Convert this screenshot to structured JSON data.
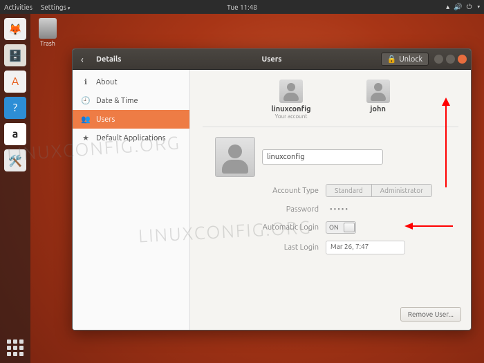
{
  "panel": {
    "activities": "Activities",
    "app_menu": "Settings",
    "clock": "Tue 11:48"
  },
  "desktop": {
    "trash_label": "Trash"
  },
  "dock": {
    "items": [
      {
        "name": "firefox",
        "bg": "#f0f0f0",
        "glyph": "🦊"
      },
      {
        "name": "files",
        "bg": "#e0ddd7",
        "glyph": "📁"
      },
      {
        "name": "software",
        "bg": "#f2f2f2",
        "glyph": "🛍️"
      },
      {
        "name": "help",
        "bg": "#2d8ed6",
        "glyph": "?"
      },
      {
        "name": "amazon",
        "bg": "#ffffff",
        "glyph": "a"
      },
      {
        "name": "settings",
        "bg": "#e9e9e9",
        "glyph": "⚙"
      }
    ]
  },
  "window": {
    "back_section": "Details",
    "title": "Users",
    "unlock_label": "Unlock"
  },
  "sidebar": {
    "items": [
      {
        "icon": "ℹ",
        "label": "About"
      },
      {
        "icon": "🕘",
        "label": "Date & Time"
      },
      {
        "icon": "👥",
        "label": "Users"
      },
      {
        "icon": "★",
        "label": "Default Applications"
      }
    ],
    "active_index": 2
  },
  "users": {
    "list": [
      {
        "name": "linuxconfig",
        "sub": "Your account"
      },
      {
        "name": "john",
        "sub": ""
      }
    ],
    "selected": {
      "name_value": "linuxconfig",
      "account_type_label": "Account Type",
      "account_type_options": [
        "Standard",
        "Administrator"
      ],
      "password_label": "Password",
      "password_value": "•••••",
      "auto_login_label": "Automatic Login",
      "auto_login_state": "ON",
      "last_login_label": "Last Login",
      "last_login_value": "Mar 26,  7:47"
    },
    "remove_label": "Remove User..."
  },
  "watermark": "LINUXCONFIG.ORG"
}
